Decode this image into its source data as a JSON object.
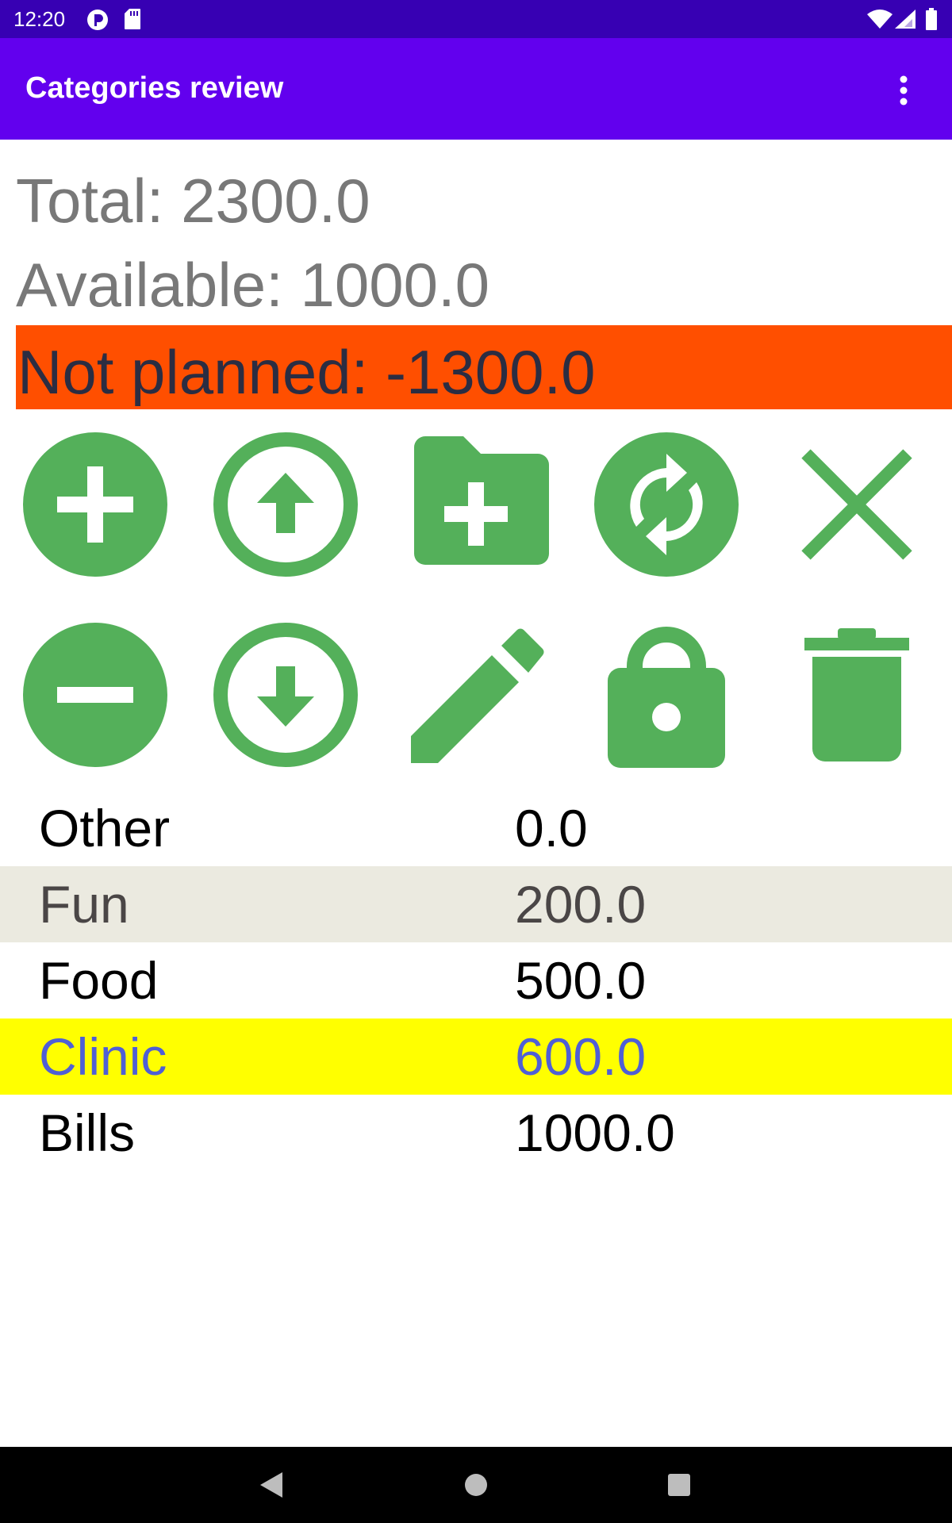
{
  "status_bar": {
    "time": "12:20",
    "icons": [
      "notification-icon",
      "sd-card-icon",
      "wifi-icon",
      "signal-icon",
      "battery-icon"
    ]
  },
  "app_bar": {
    "title": "Categories review",
    "menu_icon": "more-vert-icon"
  },
  "summary": {
    "total": "Total: 2300.0",
    "available": "Available: 1000.0",
    "not_planned": "Not planned: -1300.0"
  },
  "toolbar": {
    "row1": [
      "add-circle-icon",
      "move-up-icon",
      "create-folder-icon",
      "sync-icon",
      "close-icon"
    ],
    "row2": [
      "remove-circle-icon",
      "move-down-icon",
      "edit-icon",
      "lock-icon",
      "delete-icon"
    ],
    "icon_color": "#54b05a"
  },
  "categories": [
    {
      "name": "Other",
      "value": "0.0",
      "bg": "#ffffff",
      "fg": "#000000"
    },
    {
      "name": "Fun",
      "value": "200.0",
      "bg": "#ebeae0",
      "fg": "#4a4646"
    },
    {
      "name": "Food",
      "value": "500.0",
      "bg": "#ffffff",
      "fg": "#000000"
    },
    {
      "name": "Clinic",
      "value": "600.0",
      "bg": "#ffff00",
      "fg": "#4f5fd5"
    },
    {
      "name": "Bills",
      "value": "1000.0",
      "bg": "#ffffff",
      "fg": "#000000"
    }
  ],
  "colors": {
    "status_bar": "#3700b3",
    "app_bar": "#6200ee",
    "not_planned_bg": "#ff4f00"
  },
  "nav_bar": {
    "icons": [
      "back-icon",
      "home-icon",
      "recents-icon"
    ]
  }
}
